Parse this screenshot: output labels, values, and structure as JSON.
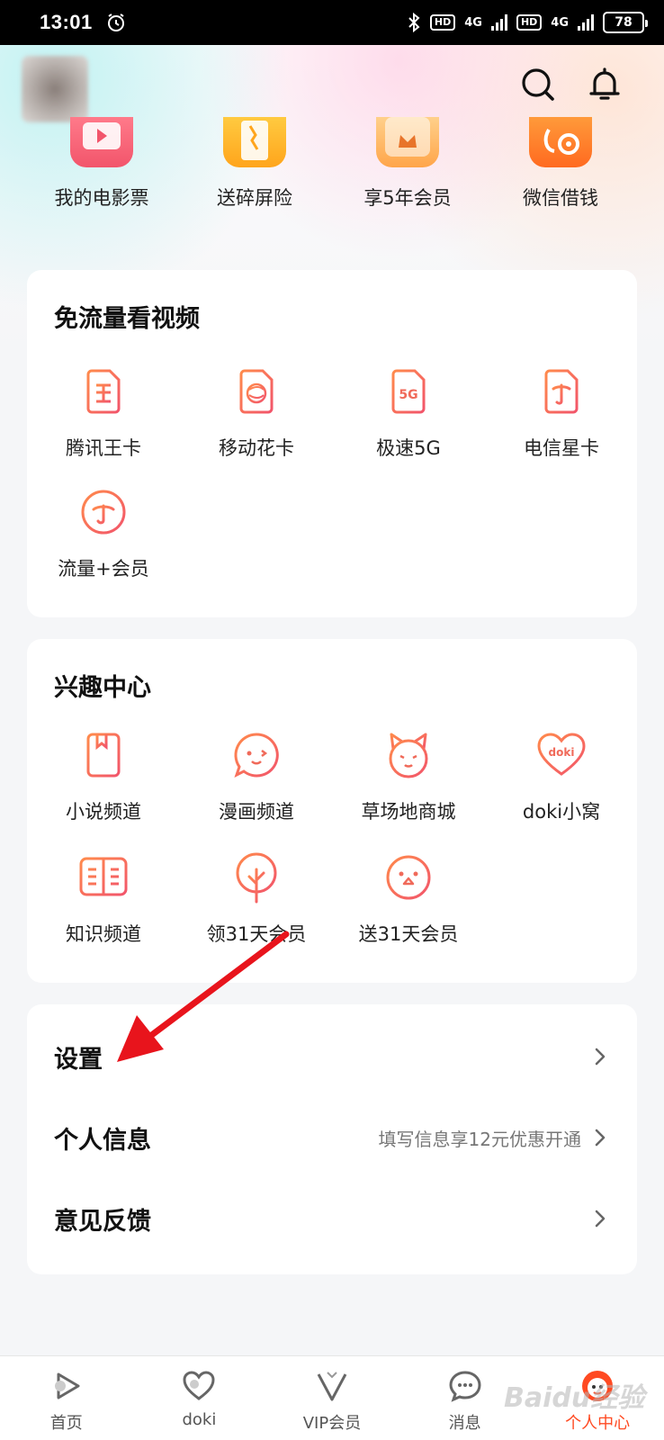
{
  "status_bar": {
    "time": "13:01",
    "hd1": "HD",
    "net1": "4G",
    "hd2": "HD",
    "net2": "4G",
    "battery": "78"
  },
  "header": {
    "avatar_icon": "avatar-blurred",
    "search_icon": "search-icon",
    "bell_icon": "bell-icon"
  },
  "quick_actions": [
    {
      "label": "我的电影票",
      "icon": "movie-ticket-icon",
      "color": "#ff5c7a"
    },
    {
      "label": "送碎屏险",
      "icon": "screen-insurance-icon",
      "color": "#ffb020"
    },
    {
      "label": "享5年会员",
      "icon": "crown-icon",
      "color": "#ffab40"
    },
    {
      "label": "微信借钱",
      "icon": "loan-icon",
      "color": "#ff7a2a"
    }
  ],
  "free_data": {
    "title": "免流量看视频",
    "items": [
      {
        "label": "腾讯王卡",
        "icon": "wang-card-icon"
      },
      {
        "label": "移动花卡",
        "icon": "mobile-card-icon"
      },
      {
        "label": "极速5G",
        "icon": "5g-card-icon"
      },
      {
        "label": "电信星卡",
        "icon": "telecom-card-icon"
      },
      {
        "label": "流量+会员",
        "icon": "telecom-circle-icon"
      }
    ]
  },
  "interest": {
    "title": "兴趣中心",
    "items": [
      {
        "label": "小说频道",
        "icon": "book-icon"
      },
      {
        "label": "漫画频道",
        "icon": "comic-face-icon"
      },
      {
        "label": "草场地商城",
        "icon": "cat-face-icon"
      },
      {
        "label": "doki小窝",
        "icon": "doki-heart-icon",
        "badge": "doki"
      },
      {
        "label": "知识频道",
        "icon": "open-book-icon"
      },
      {
        "label": "领31天会员",
        "icon": "tree-icon"
      },
      {
        "label": "送31天会员",
        "icon": "chick-face-icon"
      }
    ]
  },
  "menu": [
    {
      "label": "设置",
      "hint": ""
    },
    {
      "label": "个人信息",
      "hint": "填写信息享12元优惠开通"
    },
    {
      "label": "意见反馈",
      "hint": ""
    }
  ],
  "tabbar": [
    {
      "label": "首页",
      "icon": "home-play-icon",
      "active": false
    },
    {
      "label": "doki",
      "icon": "doki-heart-tab-icon",
      "active": false
    },
    {
      "label": "VIP会员",
      "icon": "vip-v-icon",
      "active": false
    },
    {
      "label": "消息",
      "icon": "message-bubble-icon",
      "active": false
    },
    {
      "label": "个人中心",
      "icon": "profile-mascot-icon",
      "active": true
    }
  ],
  "colors": {
    "accent": "#ff4a22",
    "icon_gradient_start": "#ff8a4c",
    "icon_gradient_end": "#f2556b",
    "annotation_arrow": "#e8141c"
  },
  "watermark": "Baidu经验"
}
